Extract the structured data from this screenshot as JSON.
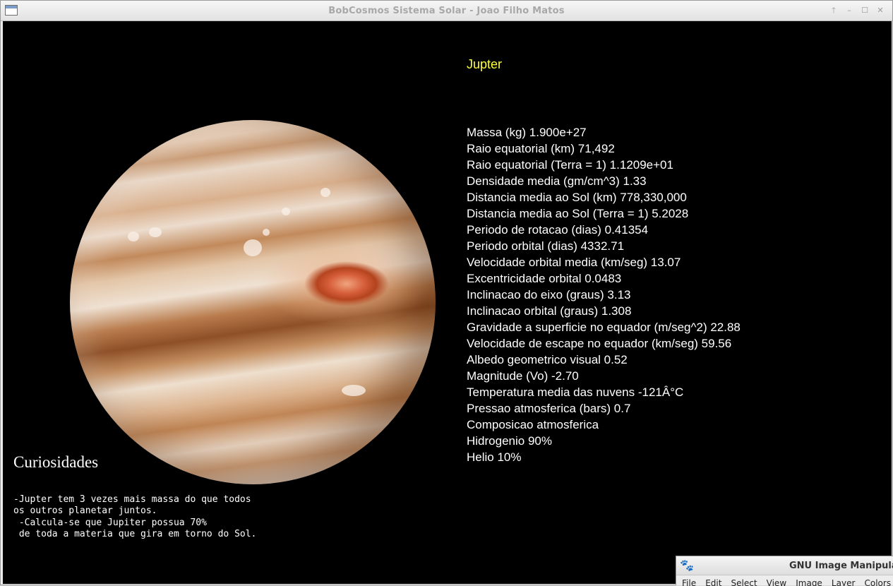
{
  "window": {
    "title": "BobCosmos Sistema Solar - Joao Filho Matos",
    "controls": {
      "up": "🡑",
      "minimize": "–",
      "maximize": "☐",
      "close": "✕"
    }
  },
  "planet": {
    "name": "Jupter",
    "stats": [
      "Massa (kg) 1.900e+27",
      "Raio equatorial (km) 71,492",
      "Raio equatorial (Terra = 1) 1.1209e+01",
      "Densidade media (gm/cm^3) 1.33",
      "Distancia media ao Sol (km) 778,330,000",
      "Distancia media ao Sol (Terra = 1) 5.2028",
      "Periodo de rotacao (dias) 0.41354",
      "Periodo orbital (dias) 4332.71",
      "Velocidade orbital media (km/seg) 13.07",
      "Excentricidade orbital 0.0483",
      "Inclinacao do eixo (graus) 3.13",
      "Inclinacao orbital (graus) 1.308",
      "Gravidade a superficie no equador (m/seg^2) 22.88",
      "Velocidade de escape no equador (km/seg) 59.56",
      "Albedo geometrico visual 0.52",
      "Magnitude (Vo) -2.70",
      "Temperatura media das nuvens -121Â°C",
      "Pressao atmosferica (bars) 0.7",
      "Composicao atmosferica",
      "Hidrogenio 90%",
      "Helio 10%"
    ]
  },
  "curiosidades": {
    "title": "Curiosidades",
    "lines": [
      "-Jupter tem 3 vezes mais massa do que todos",
      "os outros planetar juntos.",
      " -Calcula-se que Jupiter possua 70%",
      " de toda a materia que gira em torno do Sol."
    ]
  },
  "gimp": {
    "title": "GNU Image Manipula",
    "menu": [
      "File",
      "Edit",
      "Select",
      "View",
      "Image",
      "Layer",
      "Colors"
    ]
  }
}
